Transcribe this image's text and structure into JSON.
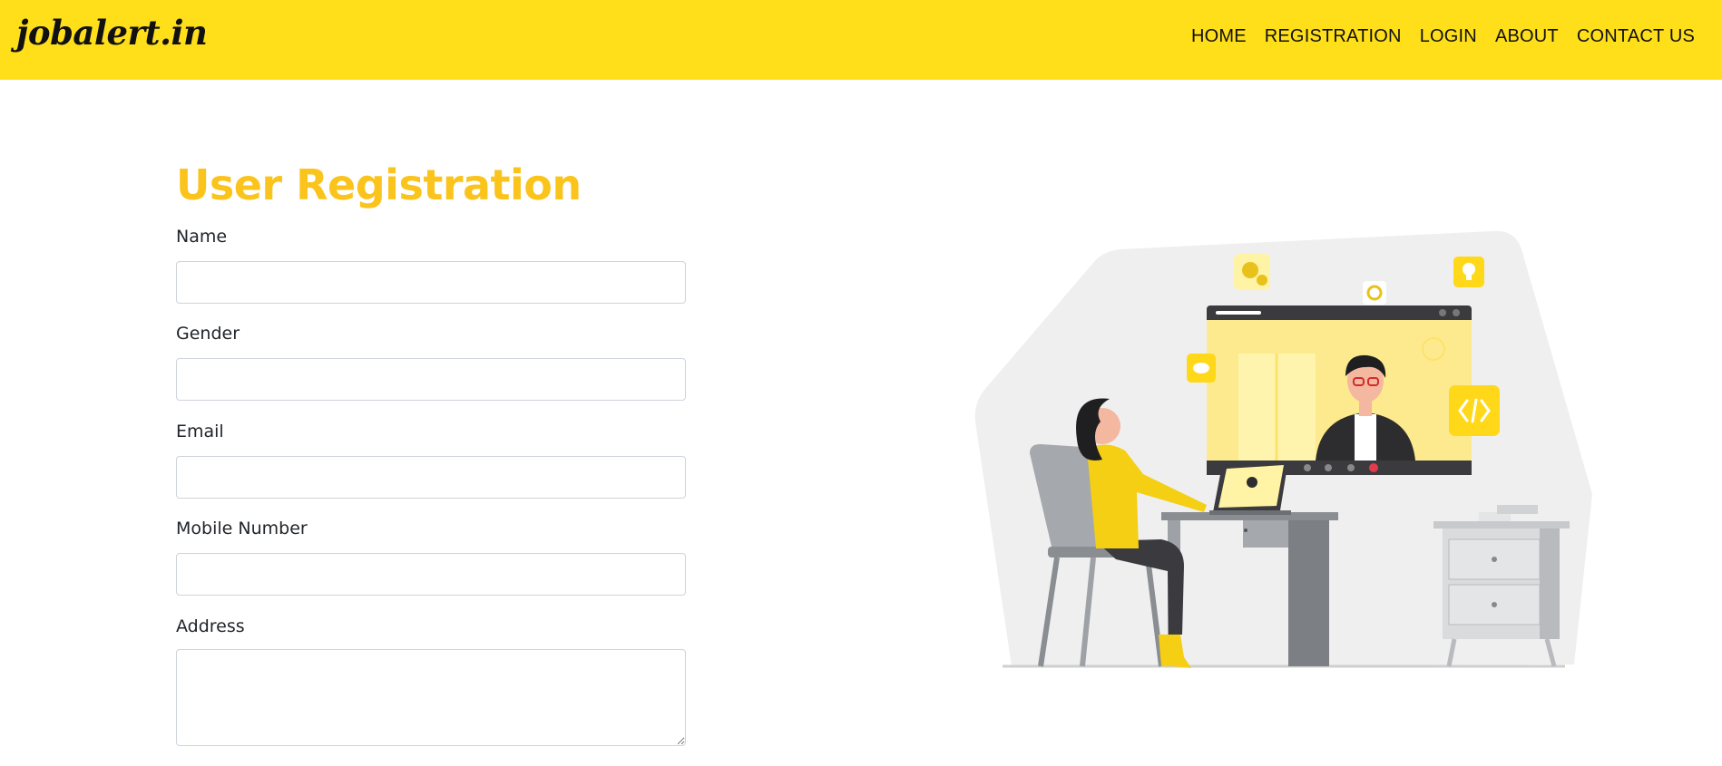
{
  "navbar": {
    "brand": "jobalert.in",
    "links": [
      "HOME",
      "REGISTRATION",
      "LOGIN",
      "ABOUT",
      "CONTACT US"
    ]
  },
  "form": {
    "title": "User Registration",
    "fields": [
      {
        "label": "Name",
        "value": ""
      },
      {
        "label": "Gender",
        "value": ""
      },
      {
        "label": "Email",
        "value": ""
      },
      {
        "label": "Mobile Number",
        "value": ""
      },
      {
        "label": "Address",
        "value": ""
      }
    ]
  },
  "colors": {
    "navbar_bg": "#ffde1a",
    "accent": "#fbc41c",
    "text": "#212529"
  },
  "illustration": {
    "icons": [
      "gear-icon",
      "target-icon",
      "lightbulb-icon",
      "handshake-icon",
      "code-icon",
      "clock-icon",
      "end-call-icon"
    ]
  }
}
